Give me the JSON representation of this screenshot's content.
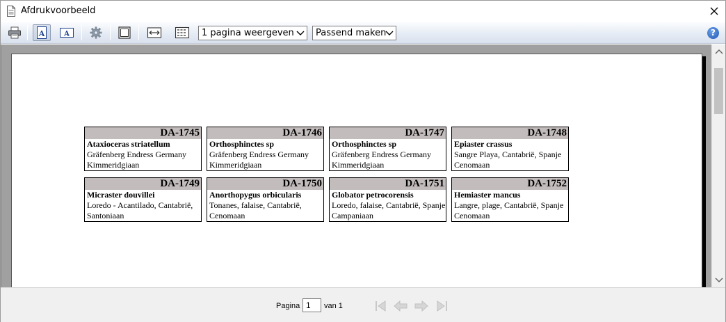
{
  "window": {
    "title": "Afdrukvoorbeeld"
  },
  "toolbar": {
    "pages_select": "1 pagina weergeven",
    "zoom_select": "Passend maken",
    "help_label": "?"
  },
  "labels": [
    {
      "code": "DA-1745",
      "name": "Ataxioceras striatellum",
      "location": "Gräfenberg Endress Germany",
      "stage": "Kimmeridgiaan"
    },
    {
      "code": "DA-1746",
      "name": "Orthosphinctes sp",
      "location": "Gräfenberg Endress Germany",
      "stage": "Kimmeridgiaan"
    },
    {
      "code": "DA-1747",
      "name": "Orthosphinctes sp",
      "location": "Gräfenberg Endress Germany",
      "stage": "Kimmeridgiaan"
    },
    {
      "code": "DA-1748",
      "name": "Epiaster crassus",
      "location": "Sangre Playa, Cantabrië, Spanje",
      "stage": "Cenomaan"
    },
    {
      "code": "DA-1749",
      "name": "Micraster douvillei",
      "location": "Loredo - Acantilado, Cantabrië,",
      "stage": "Santoniaan"
    },
    {
      "code": "DA-1750",
      "name": "Anorthopygus orbicularis",
      "location": "Tonanes, falaise, Cantabrië,",
      "stage": "Cenomaan"
    },
    {
      "code": "DA-1751",
      "name": "Globator petrocorensis",
      "location": "Loredo, falaise, Cantabrië, Spanje",
      "stage": "Campaniaan"
    },
    {
      "code": "DA-1752",
      "name": "Hemiaster mancus",
      "location": "Langre, plage, Cantabrië, Spanje",
      "stage": "Cenomaan"
    }
  ],
  "pager": {
    "label": "Pagina",
    "current_page": "1",
    "of_text": "van 1"
  },
  "colors": {
    "label_header": "#c3bcbc",
    "preview_bg": "#a0a0a0",
    "help_blue": "#1c56b4"
  }
}
